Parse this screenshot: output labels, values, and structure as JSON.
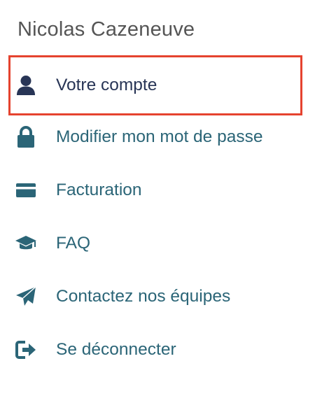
{
  "user": {
    "name": "Nicolas Cazeneuve"
  },
  "menu": {
    "items": [
      {
        "label": "Votre compte",
        "icon": "user-icon",
        "active": true
      },
      {
        "label": "Modifier mon mot de passe",
        "icon": "lock-icon",
        "active": false
      },
      {
        "label": "Facturation",
        "icon": "credit-card-icon",
        "active": false
      },
      {
        "label": "FAQ",
        "icon": "graduation-cap-icon",
        "active": false
      },
      {
        "label": "Contactez nos équipes",
        "icon": "paper-plane-icon",
        "active": false
      },
      {
        "label": "Se déconnecter",
        "icon": "sign-out-icon",
        "active": false
      }
    ]
  },
  "colors": {
    "active_border": "#e5432f",
    "active_text": "#283556",
    "link_text": "#2b6577",
    "name_text": "#555555"
  }
}
